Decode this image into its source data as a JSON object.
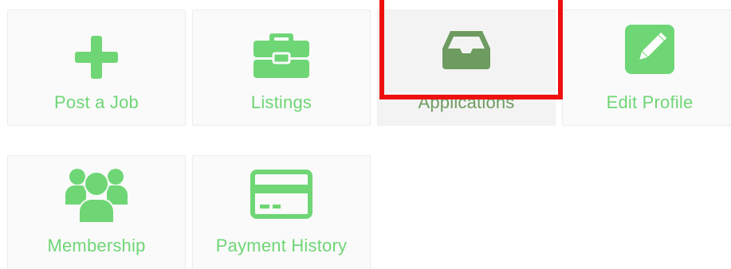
{
  "colors": {
    "accent": "#6fd676",
    "active_icon": "#6e9b60",
    "highlight": "#ee0f0f"
  },
  "tiles": [
    {
      "label": "Post a Job",
      "icon": "plus-icon"
    },
    {
      "label": "Listings",
      "icon": "briefcase-icon"
    },
    {
      "label": "Applications",
      "icon": "inbox-tray-icon",
      "active": true
    },
    {
      "label": "Edit Profile",
      "icon": "pencil-square-icon"
    },
    {
      "label": "Membership",
      "icon": "users-group-icon"
    },
    {
      "label": "Payment History",
      "icon": "credit-card-icon"
    }
  ]
}
